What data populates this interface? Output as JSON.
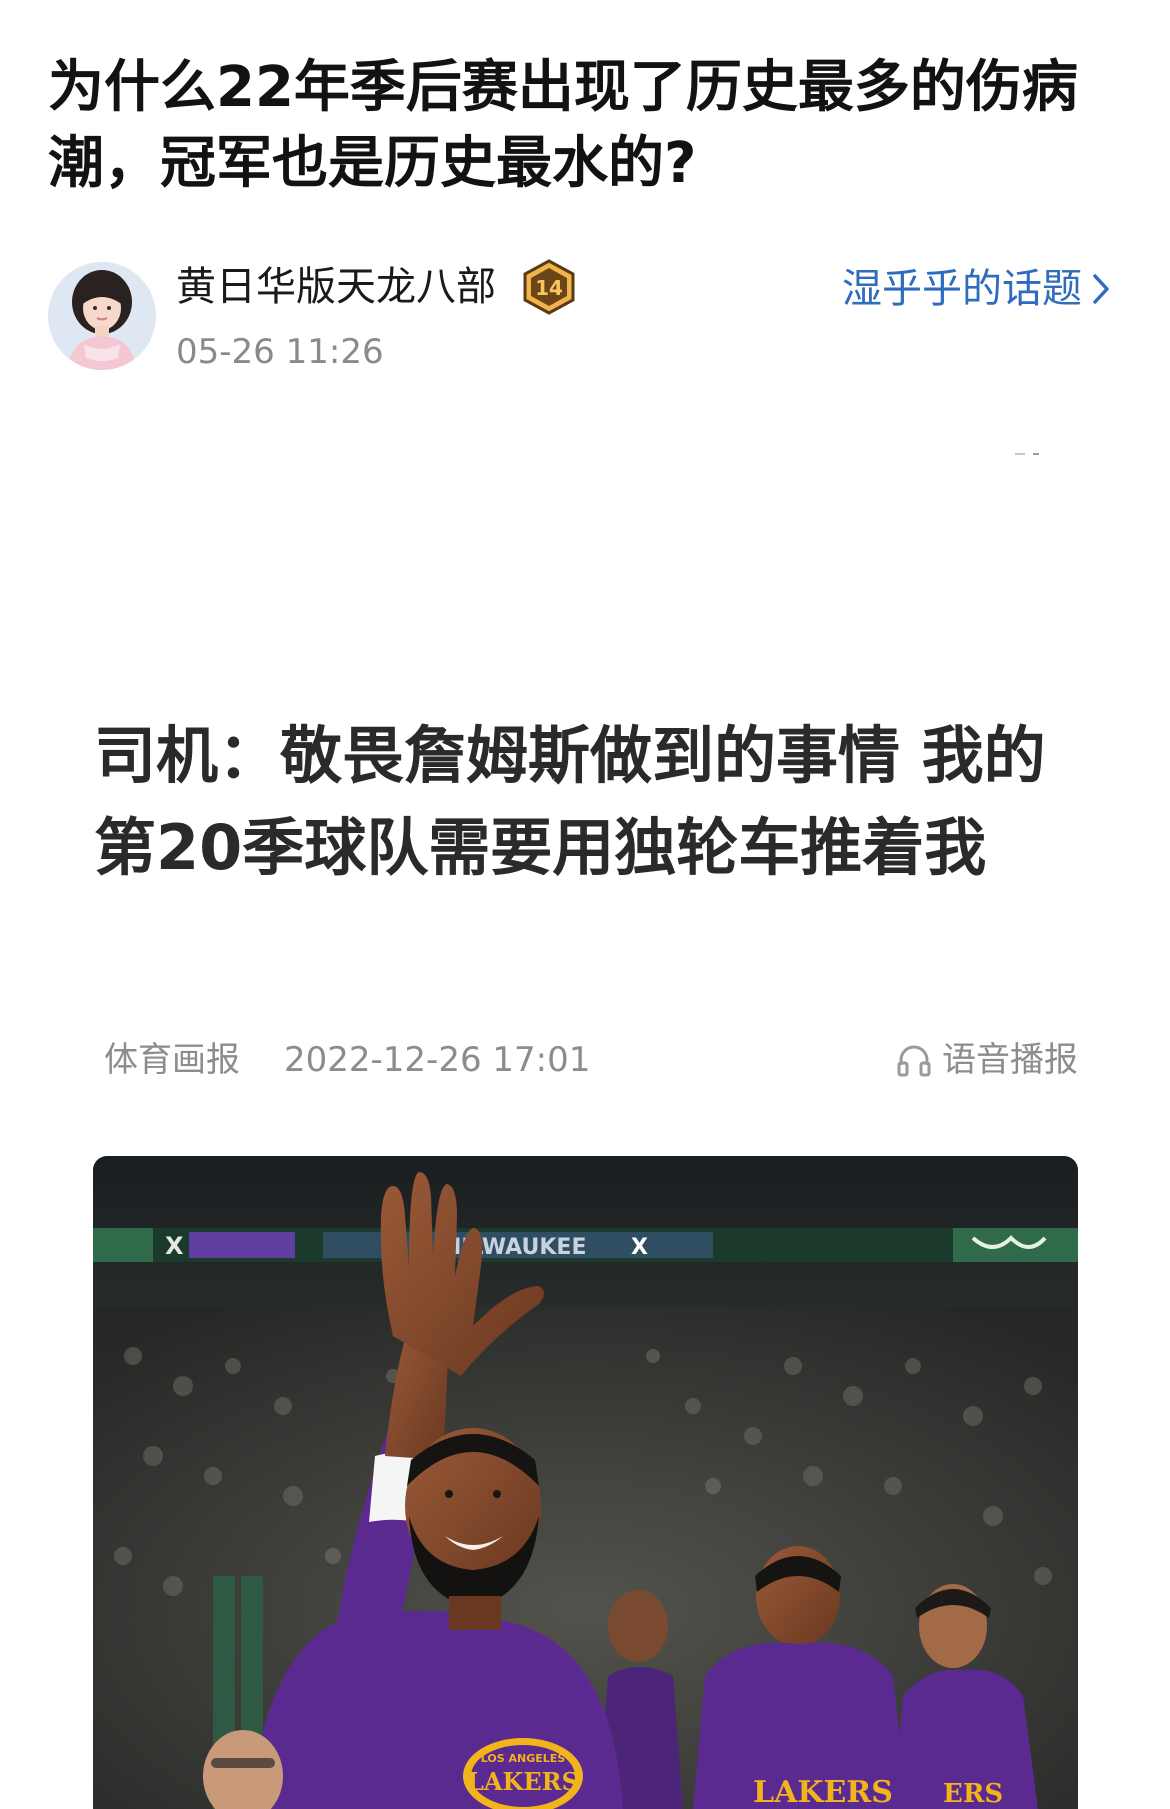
{
  "post": {
    "title": "为什么22年季后赛出现了历史最多的伤病潮，冠军也是历史最水的?",
    "author_name": "黄日华版天龙八部",
    "time": "05-26 11:26",
    "topic_link": "湿乎乎的话题",
    "badge_text": "14"
  },
  "screenshot": {
    "headline": "司机：敬畏詹姆斯做到的事情 我的第20季球队需要用独轮车推着我",
    "source": "体育画报",
    "datetime": "2022-12-26 17:01",
    "audio_label": "语音播报"
  },
  "photo": {
    "banner_left_word": "X",
    "banner_center_text": "MILWAUKEE",
    "banner_center_x": "X",
    "logo_top": "LOS ANGELES",
    "logo_main": "LAKERS",
    "jersey_right_1": "LAKERS",
    "jersey_right_2": "ERS"
  },
  "icons": {
    "chevron": "chevron-right-icon",
    "audio": "headphones-icon",
    "badge": "level-badge-icon",
    "avatar": "user-avatar"
  },
  "colors": {
    "link": "#2f6bbf",
    "meta_gray": "#8c8c8c",
    "lakers_purple": "#5b2a91",
    "lakers_gold": "#f2b41b"
  }
}
